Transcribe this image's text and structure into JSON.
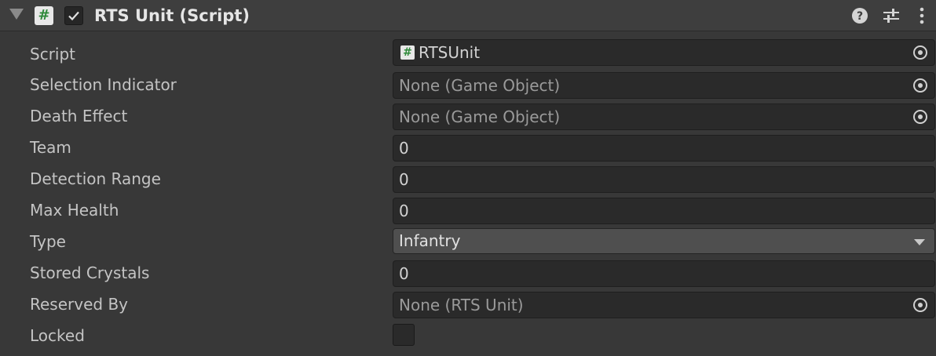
{
  "component": {
    "title": "RTS Unit (Script)",
    "enabled": true,
    "script_glyph": "#",
    "header_icons": [
      "help-icon",
      "presets-icon",
      "kebab-menu-icon"
    ]
  },
  "fields": {
    "script": {
      "label": "Script",
      "value": "RTSUnit",
      "glyph": "#"
    },
    "selection_indicator": {
      "label": "Selection Indicator",
      "value": "None (Game Object)"
    },
    "death_effect": {
      "label": "Death Effect",
      "value": "None (Game Object)"
    },
    "team": {
      "label": "Team",
      "value": "0"
    },
    "detection_range": {
      "label": "Detection Range",
      "value": "0"
    },
    "max_health": {
      "label": "Max Health",
      "value": "0"
    },
    "type": {
      "label": "Type",
      "value": "Infantry"
    },
    "stored_crystals": {
      "label": "Stored Crystals",
      "value": "0"
    },
    "reserved_by": {
      "label": "Reserved By",
      "value": "None (RTS Unit)"
    },
    "locked": {
      "label": "Locked",
      "checked": false
    }
  },
  "colors": {
    "panel_bg": "#383838",
    "header_bg": "#3e3e3e",
    "field_bg": "#2a2a2a",
    "dropdown_bg": "#4f4f4f",
    "script_icon_green": "#2f8a3a"
  }
}
